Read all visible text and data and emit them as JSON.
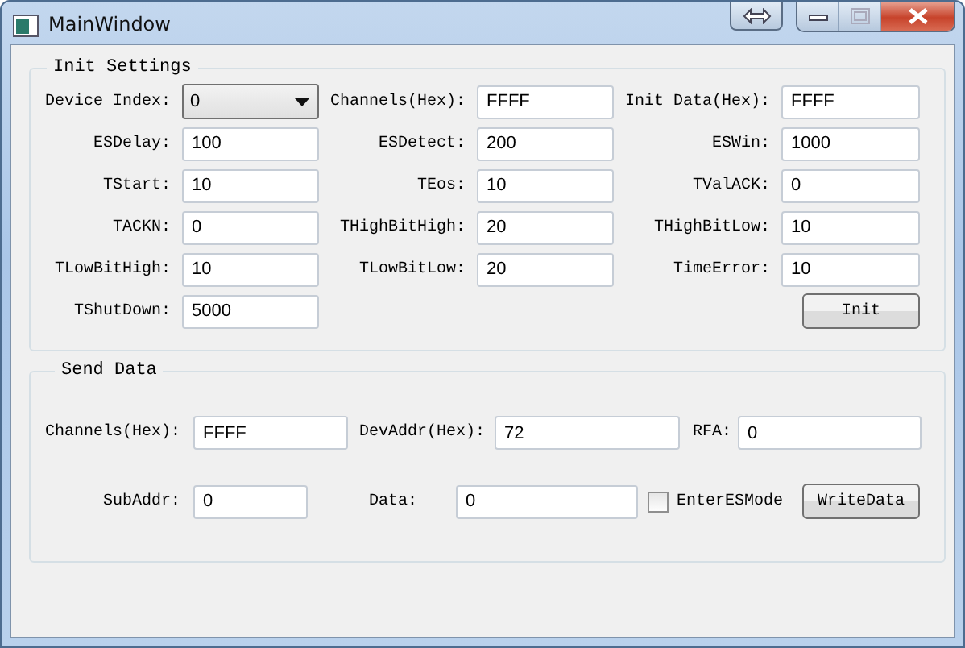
{
  "window": {
    "title": "MainWindow"
  },
  "init_settings": {
    "title": "Init Settings",
    "fields": [
      {
        "label": "Device Index:",
        "value": "0",
        "kind": "combo"
      },
      {
        "label": "Channels(Hex):",
        "value": "FFFF",
        "kind": "text"
      },
      {
        "label": "Init Data(Hex):",
        "value": "FFFF",
        "kind": "text"
      },
      {
        "label": "ESDelay:",
        "value": "100",
        "kind": "text"
      },
      {
        "label": "ESDetect:",
        "value": "200",
        "kind": "text"
      },
      {
        "label": "ESWin:",
        "value": "1000",
        "kind": "text"
      },
      {
        "label": "TStart:",
        "value": "10",
        "kind": "text"
      },
      {
        "label": "TEos:",
        "value": "10",
        "kind": "text"
      },
      {
        "label": "TValACK:",
        "value": "0",
        "kind": "text"
      },
      {
        "label": "TACKN:",
        "value": "0",
        "kind": "text"
      },
      {
        "label": "THighBitHigh:",
        "value": "20",
        "kind": "text"
      },
      {
        "label": "THighBitLow:",
        "value": "10",
        "kind": "text"
      },
      {
        "label": "TLowBitHigh:",
        "value": "10",
        "kind": "text"
      },
      {
        "label": "TLowBitLow:",
        "value": "20",
        "kind": "text"
      },
      {
        "label": "TimeError:",
        "value": "10",
        "kind": "text"
      },
      {
        "label": "TShutDown:",
        "value": "5000",
        "kind": "text"
      }
    ],
    "button": "Init"
  },
  "send_data": {
    "title": "Send Data",
    "channels": {
      "label": "Channels(Hex):",
      "value": "FFFF"
    },
    "dev_addr": {
      "label": "DevAddr(Hex):",
      "value": "72"
    },
    "rfa": {
      "label": "RFA:",
      "value": "0"
    },
    "sub_addr": {
      "label": "SubAddr:",
      "value": "0"
    },
    "data": {
      "label": "Data:",
      "value": "0"
    },
    "enter_es_mode": {
      "label": "EnterESMode",
      "checked": false
    },
    "button": "WriteData"
  }
}
